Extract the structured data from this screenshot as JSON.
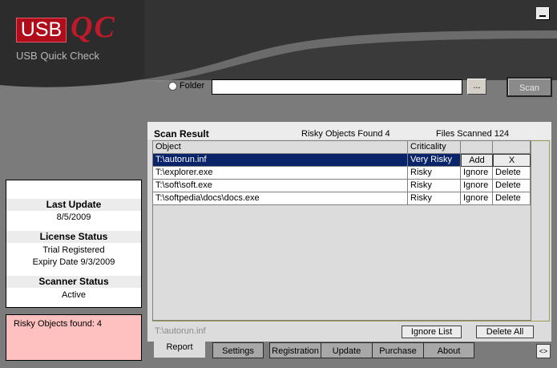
{
  "app": {
    "logo_left": "USB",
    "logo_right": "QC",
    "subtitle": "USB Quick Check"
  },
  "folder": {
    "label": "Folder",
    "value": "",
    "browse_label": "...",
    "scan_label": "Scan"
  },
  "info": {
    "last_update_label": "Last Update",
    "last_update_value": "8/5/2009",
    "license_label": "License Status",
    "license_line1": "Trial Registered",
    "license_line2": "Expiry Date 9/3/2009",
    "scanner_label": "Scanner Status",
    "scanner_value": "Active"
  },
  "risky_summary": "Risky Objects found: 4",
  "result": {
    "title": "Scan Result",
    "risky_found": "Risky Objects Found  4",
    "files_scanned": "Files Scanned  124",
    "columns": [
      "Object",
      "Criticality"
    ],
    "rows": [
      {
        "object": "T:\\autorun.inf",
        "criticality": "Very Risky",
        "action1": "Add",
        "action2": "X"
      },
      {
        "object": "T:\\explorer.exe",
        "criticality": "Risky",
        "action1": "Ignore",
        "action2": "Delete"
      },
      {
        "object": "T:\\soft\\soft.exe",
        "criticality": "Risky",
        "action1": "Ignore",
        "action2": "Delete"
      },
      {
        "object": "T:\\softpedia\\docs\\docs.exe",
        "criticality": "Risky",
        "action1": "Ignore",
        "action2": "Delete"
      }
    ],
    "selected_path": "T:\\autorun.inf",
    "ignore_list_label": "Ignore List",
    "delete_all_label": "Delete All"
  },
  "tabs": [
    {
      "label": "Report"
    },
    {
      "label": "Settings"
    },
    {
      "label": "Registration"
    },
    {
      "label": "Update"
    },
    {
      "label": "Purchase"
    },
    {
      "label": "About"
    }
  ],
  "nav_label": "<>",
  "colors": {
    "brand_red": "#b00d1a",
    "selection": "#0a246a",
    "risky_bg": "#ffc0c0",
    "background": "#7b7b7b"
  }
}
